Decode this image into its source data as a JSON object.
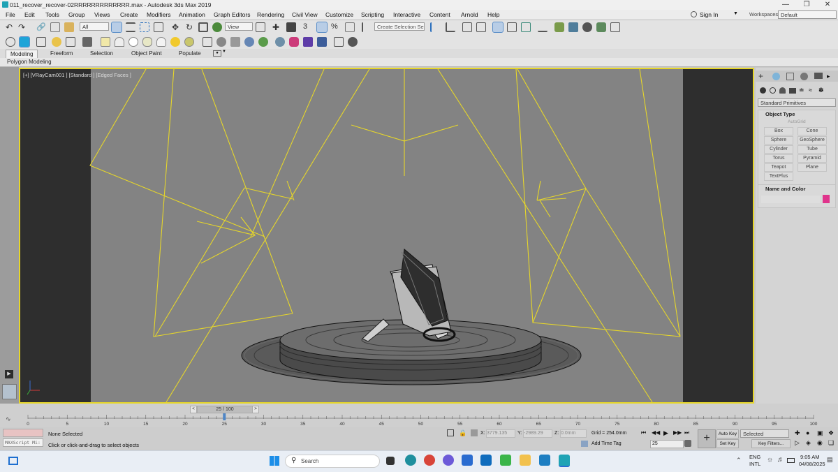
{
  "window": {
    "title": "011_recover_recover-02RRRRRRRRRRRRR.max - Autodesk 3ds Max 2019"
  },
  "menubar": {
    "items": [
      "File",
      "Edit",
      "Tools",
      "Group",
      "Views",
      "Create",
      "Modifiers",
      "Animation",
      "Graph Editors",
      "Rendering",
      "Civil View",
      "Customize",
      "Scripting",
      "Interactive",
      "Content",
      "Arnold",
      "Help"
    ],
    "sign_in": "Sign In",
    "workspaces_label": "Workspaces:",
    "workspace_value": "Default"
  },
  "toolbar": {
    "selection_filter": "All",
    "ref_coord": "View",
    "selection_set_placeholder": "Create Selection Se"
  },
  "ribbon": {
    "tabs": [
      "Modeling",
      "Freeform",
      "Selection",
      "Object Paint",
      "Populate"
    ],
    "active_tab": "Modeling",
    "sub_label": "Polygon Modeling"
  },
  "viewport": {
    "label": "[+] [VRayCam001 ] [Standard ] [Edged Faces ]"
  },
  "command_panel": {
    "category": "Standard Primitives",
    "object_type_title": "Object Type",
    "autogrid": "AutoGrid",
    "primitives": [
      "Box",
      "Cone",
      "Sphere",
      "GeoSphere",
      "Cylinder",
      "Tube",
      "Torus",
      "Pyramid",
      "Teapot",
      "Plane",
      "TextPlus"
    ],
    "name_color_title": "Name and Color",
    "object_color": "#e0348c"
  },
  "timeline": {
    "frame_display": "25 / 100",
    "current_frame": 25,
    "total_frames": 100,
    "ticks": [
      "0",
      "5",
      "10",
      "15",
      "20",
      "25",
      "30",
      "35",
      "40",
      "45",
      "50",
      "55",
      "60",
      "65",
      "70",
      "75",
      "80",
      "85",
      "90",
      "95",
      "100"
    ]
  },
  "status": {
    "selection": "None Selected",
    "prompt": "Click or click-and-drag to select objects",
    "maxscript": "MAXScript Mi:",
    "x_label": "X:",
    "x_value": "3779.135",
    "y_label": "Y:",
    "y_value": "-2989.29",
    "z_label": "Z:",
    "z_value": "0.0mm",
    "grid": "Grid = 254.0mm",
    "add_time_tag": "Add Time Tag",
    "auto_key": "Auto Key",
    "set_key": "Set Key",
    "key_mode": "Selected",
    "key_filters": "Key Filters...",
    "frame_spinner": "25"
  },
  "taskbar": {
    "search_placeholder": "Search",
    "language_top": "ENG",
    "language_bottom": "INTL",
    "time": "9:05 AM",
    "date": "04/08/2025"
  },
  "colors": {
    "viewport_bg": "#838383",
    "wireframe_yellow": "#e6d62a",
    "active_border": "#e6d62a",
    "ui_panel": "#d4d4d4"
  }
}
